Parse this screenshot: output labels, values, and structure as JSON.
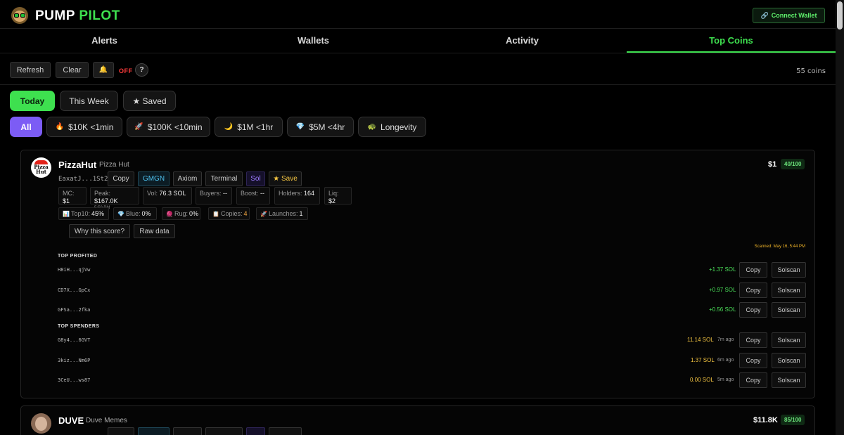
{
  "header": {
    "brand_part1": "PUMP",
    "brand_part2": "PILOT",
    "connect_label": "Connect Wallet"
  },
  "tabs": [
    {
      "label": "Alerts"
    },
    {
      "label": "Wallets"
    },
    {
      "label": "Activity"
    },
    {
      "label": "Top Coins"
    }
  ],
  "toolbar": {
    "refresh_label": "Refresh",
    "clear_label": "Clear",
    "sound_state": "OFF",
    "help_label": "?",
    "coin_count": "55 coins"
  },
  "periods": [
    {
      "label": "Today"
    },
    {
      "label": "This Week"
    },
    {
      "label": "★ Saved"
    }
  ],
  "filters": [
    {
      "label": "All",
      "icon": ""
    },
    {
      "label": "$10K <1min",
      "icon": "🔥"
    },
    {
      "label": "$100K <10min",
      "icon": "🚀"
    },
    {
      "label": "$1M <1hr",
      "icon": "🌙"
    },
    {
      "label": "$5M <4hr",
      "icon": "💎"
    },
    {
      "label": "Longevity",
      "icon": "🐢"
    }
  ],
  "colors": {
    "accent_green": "#3ee04f",
    "filter_purple": "#7c5cf5",
    "negative_red": "#ff3b3b",
    "gain_green": "#4be05a",
    "amount_yellow": "#f4c542"
  },
  "coins": [
    {
      "logo_text": "Pizza Hut",
      "symbol": "PizzaHut",
      "name": "Pizza Hut",
      "price": "$1",
      "score": "40/100",
      "address": "EaxatJ...1St2",
      "chips": {
        "copy": "Copy",
        "gmgn": "GMGN",
        "axiom": "Axiom",
        "terminal": "Terminal",
        "sol": "Sol",
        "save": "★ Save"
      },
      "stats": {
        "mc_label": "MC:",
        "mc_value": "$1",
        "peak_label": "Peak:",
        "peak_value": "$167.0K",
        "peak_time": "5:50 PM",
        "vol_label": "Vol:",
        "vol_value": "76.3 SOL",
        "buyers_label": "Buyers:",
        "buyers_value": "--",
        "boost_label": "Boost:",
        "boost_value": "--",
        "holders_label": "Holders:",
        "holders_value": "164",
        "liq_label": "Liq:",
        "liq_value": "$2"
      },
      "stats2": {
        "top10_label": "Top10:",
        "top10_value": "45%",
        "blue_label": "Blue:",
        "blue_value": "0%",
        "rug_label": "Rug:",
        "rug_value": "0%",
        "copies_label": "Copies:",
        "copies_value": "4",
        "launches_label": "Launches:",
        "launches_value": "1"
      },
      "why_label": "Why this score?",
      "raw_label": "Raw data",
      "scanned": "Scanned: May 16, 5:44 PM",
      "top_profited_title": "TOP PROFITED",
      "top_profited": [
        {
          "address": "H8iH...qjVw",
          "amount": "+1.37 SOL",
          "copy": "Copy",
          "solscan": "Solscan"
        },
        {
          "address": "CD7X...GpCx",
          "amount": "+0.97 SOL",
          "copy": "Copy",
          "solscan": "Solscan"
        },
        {
          "address": "GFSa...2fka",
          "amount": "+0.56 SOL",
          "copy": "Copy",
          "solscan": "Solscan"
        }
      ],
      "top_spenders_title": "TOP SPENDERS",
      "top_spenders": [
        {
          "address": "G8y4...6GVT",
          "amount": "11.14 SOL",
          "time": "7m ago",
          "copy": "Copy",
          "solscan": "Solscan"
        },
        {
          "address": "3kiz...Nm6P",
          "amount": "1.37 SOL",
          "time": "6m ago",
          "copy": "Copy",
          "solscan": "Solscan"
        },
        {
          "address": "3CeU...ws87",
          "amount": "0.00 SOL",
          "time": "5m ago",
          "copy": "Copy",
          "solscan": "Solscan"
        }
      ]
    },
    {
      "symbol": "DUVE",
      "name": "Duve Memes",
      "price": "$11.8K",
      "score": "85/100"
    }
  ]
}
